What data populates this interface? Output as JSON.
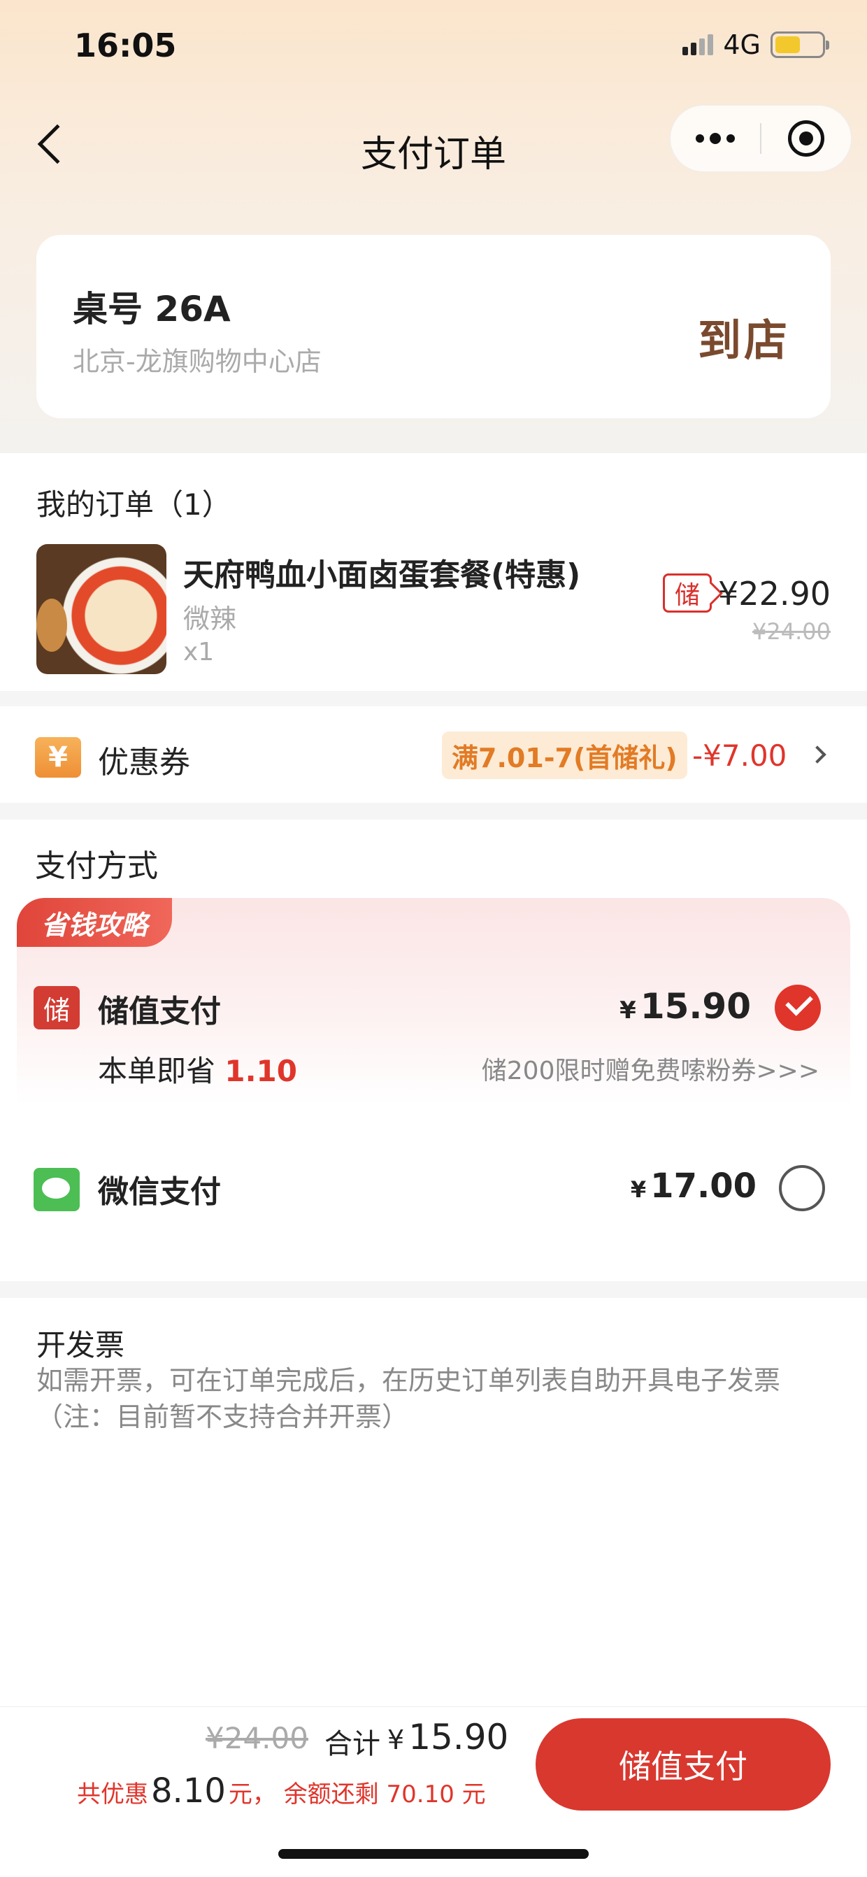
{
  "status_bar": {
    "time": "16:05",
    "network": "4G"
  },
  "nav": {
    "title": "支付订单"
  },
  "store": {
    "table_no": "桌号 26A",
    "store_name": "北京-龙旗购物中心店",
    "dine_tag": "到店"
  },
  "order": {
    "title": "我的订单（1）",
    "items": [
      {
        "name": "天府鸭血小面卤蛋套餐(特惠)",
        "spec": "微辣",
        "qty": "x1",
        "badge": "储",
        "price": "¥22.90",
        "original_price": "¥24.00"
      }
    ]
  },
  "coupon": {
    "icon": "¥",
    "label": "优惠券",
    "tag": "满7.01-7(首储礼)",
    "amount": "-¥7.00"
  },
  "payment": {
    "title": "支付方式",
    "save_tag": "省钱攻略",
    "stored": {
      "icon": "储",
      "label": "储值支付",
      "currency": "¥",
      "amount": "15.90",
      "save_prefix": "本单即省",
      "save_amount": "1.10",
      "promo": "储200限时赠免费嗦粉券>>>",
      "selected": true
    },
    "wechat": {
      "label": "微信支付",
      "currency": "¥",
      "amount": "17.00",
      "selected": false
    }
  },
  "invoice": {
    "title": "开发票",
    "line1": "如需开票，可在订单完成后，在历史订单列表自助开具电子发票",
    "line2": "（注：目前暂不支持合并开票）"
  },
  "bottom": {
    "original_total": "¥24.00",
    "total_label": "合计",
    "currency": "¥",
    "total": "15.90",
    "discount_prefix": "共优惠",
    "discount_amount": "8.10",
    "discount_unit": "元，",
    "balance_text": "余额还剩 70.10 元",
    "pay_button": "储值支付"
  },
  "colors": {
    "accent": "#d9382f",
    "coupon_orange": "#e27b25",
    "wechat_green": "#4cbe54"
  }
}
